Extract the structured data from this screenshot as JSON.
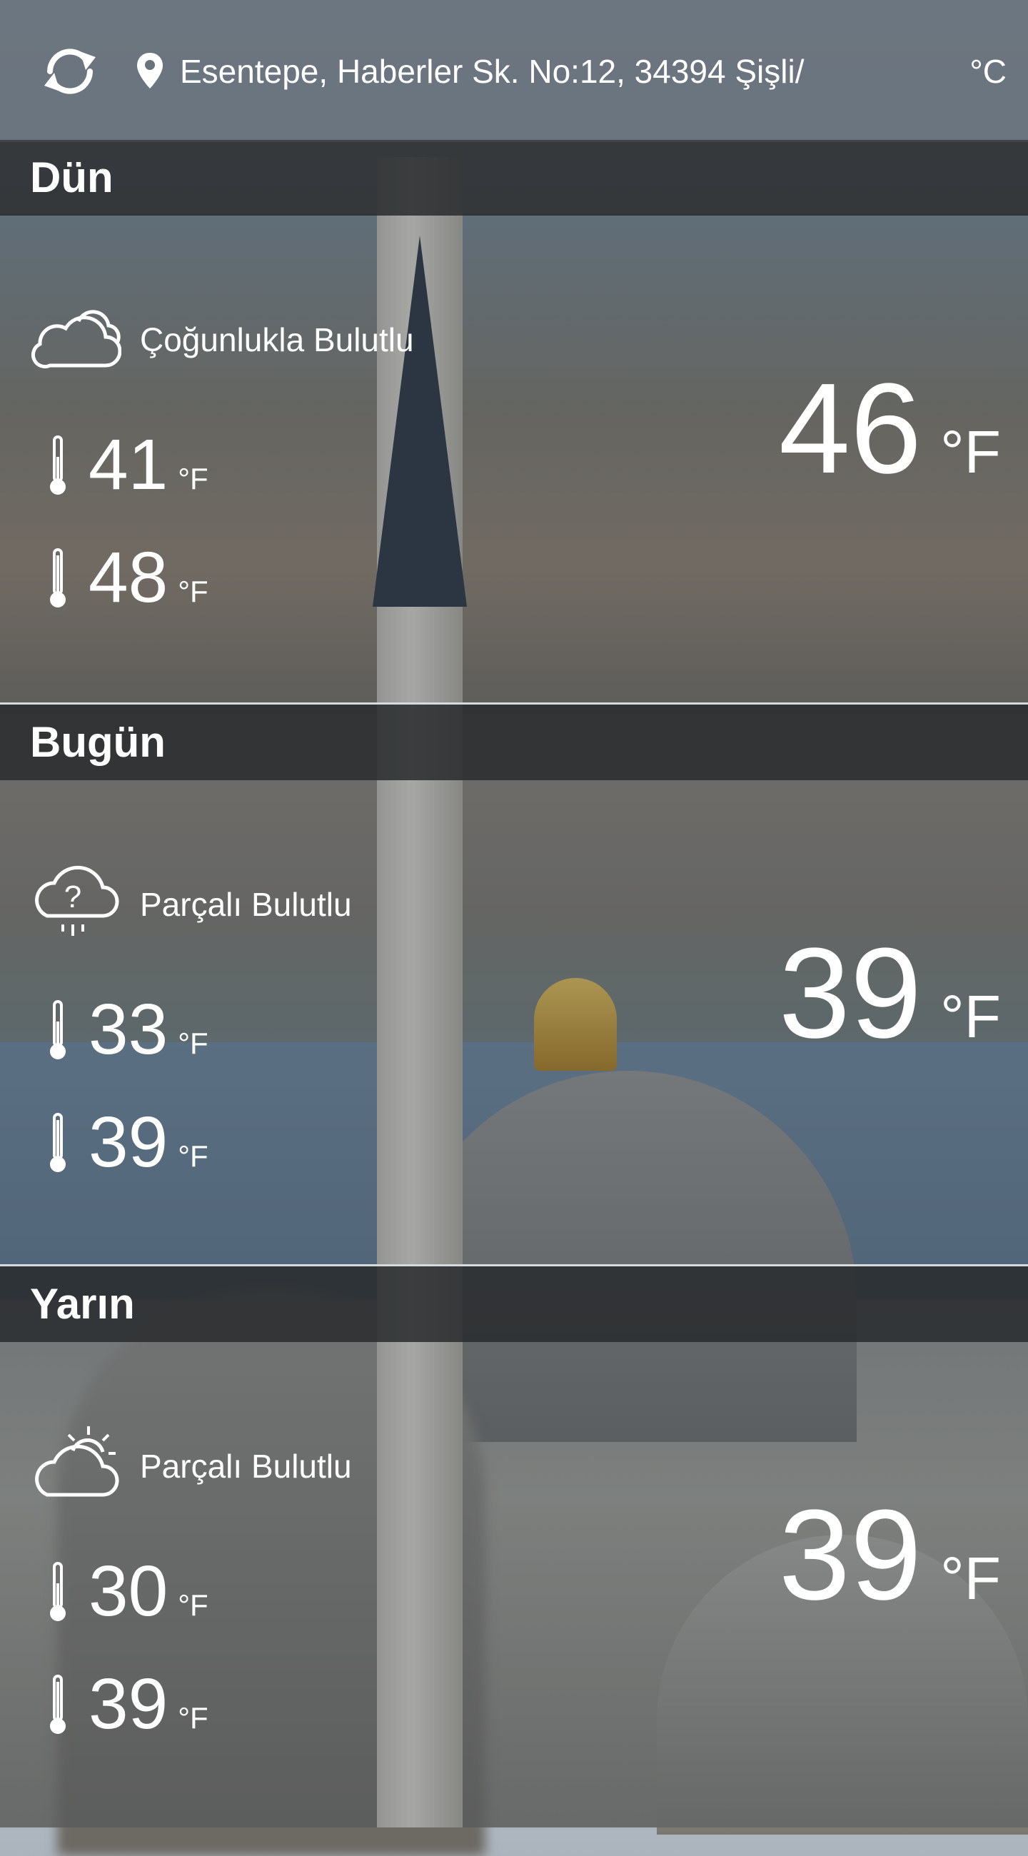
{
  "header": {
    "location": "Esentepe, Haberler Sk. No:12, 34394 Şişli/",
    "unit_toggle": "°C",
    "refresh_icon": "refresh-icon",
    "location_icon": "map-pin-icon"
  },
  "days": [
    {
      "label": "Dün",
      "condition": "Çoğunlukla Bulutlu",
      "icon": "cloudy-icon",
      "low": "41",
      "high": "48",
      "current": "46",
      "unit": "°F"
    },
    {
      "label": "Bugün",
      "condition": "Parçalı Bulutlu",
      "icon": "cloud-question-icon",
      "low": "33",
      "high": "39",
      "current": "39",
      "unit": "°F"
    },
    {
      "label": "Yarın",
      "condition": "Parçalı Bulutlu",
      "icon": "partly-sunny-icon",
      "low": "30",
      "high": "39",
      "current": "39",
      "unit": "°F"
    }
  ]
}
